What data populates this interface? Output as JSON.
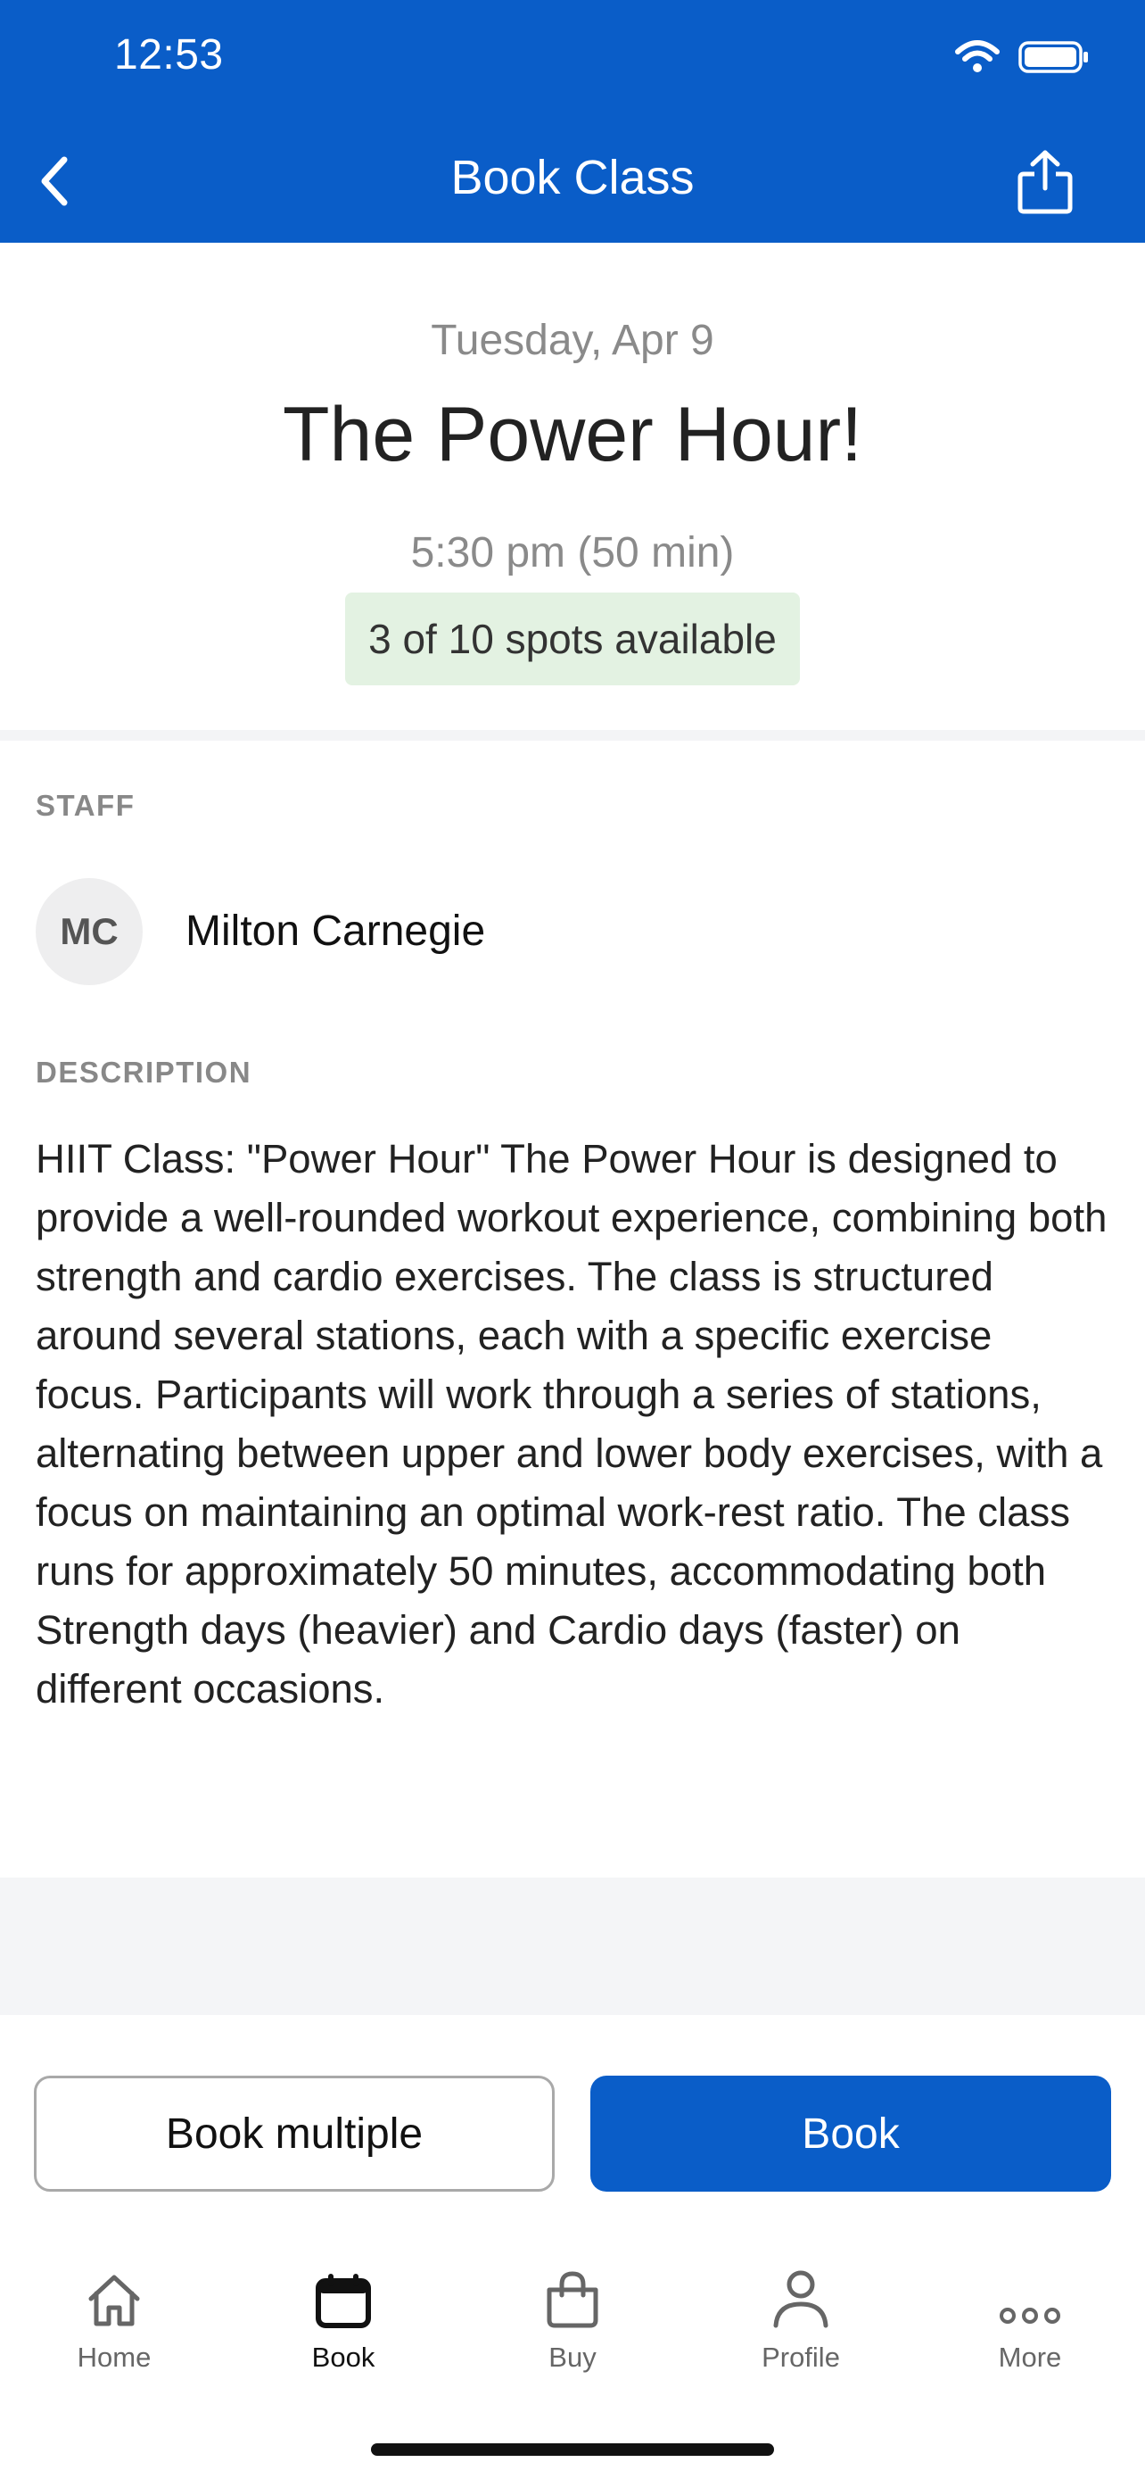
{
  "status_bar": {
    "time": "12:53"
  },
  "nav": {
    "title": "Book Class"
  },
  "class": {
    "date": "Tuesday, Apr 9",
    "title": "The Power Hour!",
    "time": "5:30 pm (50 min)",
    "spots": "3 of 10 spots available"
  },
  "staff": {
    "label": "STAFF",
    "initials": "MC",
    "name": "Milton Carnegie"
  },
  "description": {
    "label": "DESCRIPTION",
    "text": "HIIT Class: \"Power Hour\"  The Power Hour is designed to provide a well-rounded workout experience, combining both strength and cardio exercises. The class is structured around several stations, each with a specific exercise focus. Participants will work through a series of stations, alternating between upper and lower body exercises, with a focus on maintaining an optimal work-rest ratio. The class runs for approximately 50 minutes, accommodating both Strength days (heavier) and Cardio days (faster) on different occasions."
  },
  "actions": {
    "book_multiple": "Book multiple",
    "book": "Book"
  },
  "tabs": [
    {
      "label": "Home",
      "icon": "home-icon"
    },
    {
      "label": "Book",
      "icon": "calendar-icon",
      "active": true
    },
    {
      "label": "Buy",
      "icon": "shopping-bag-icon"
    },
    {
      "label": "Profile",
      "icon": "person-icon"
    },
    {
      "label": "More",
      "icon": "more-dots-icon"
    }
  ],
  "colors": {
    "primary": "#0a5dc8",
    "spots_badge_bg": "#e3f2e2",
    "muted_text": "#8a8a8a"
  }
}
